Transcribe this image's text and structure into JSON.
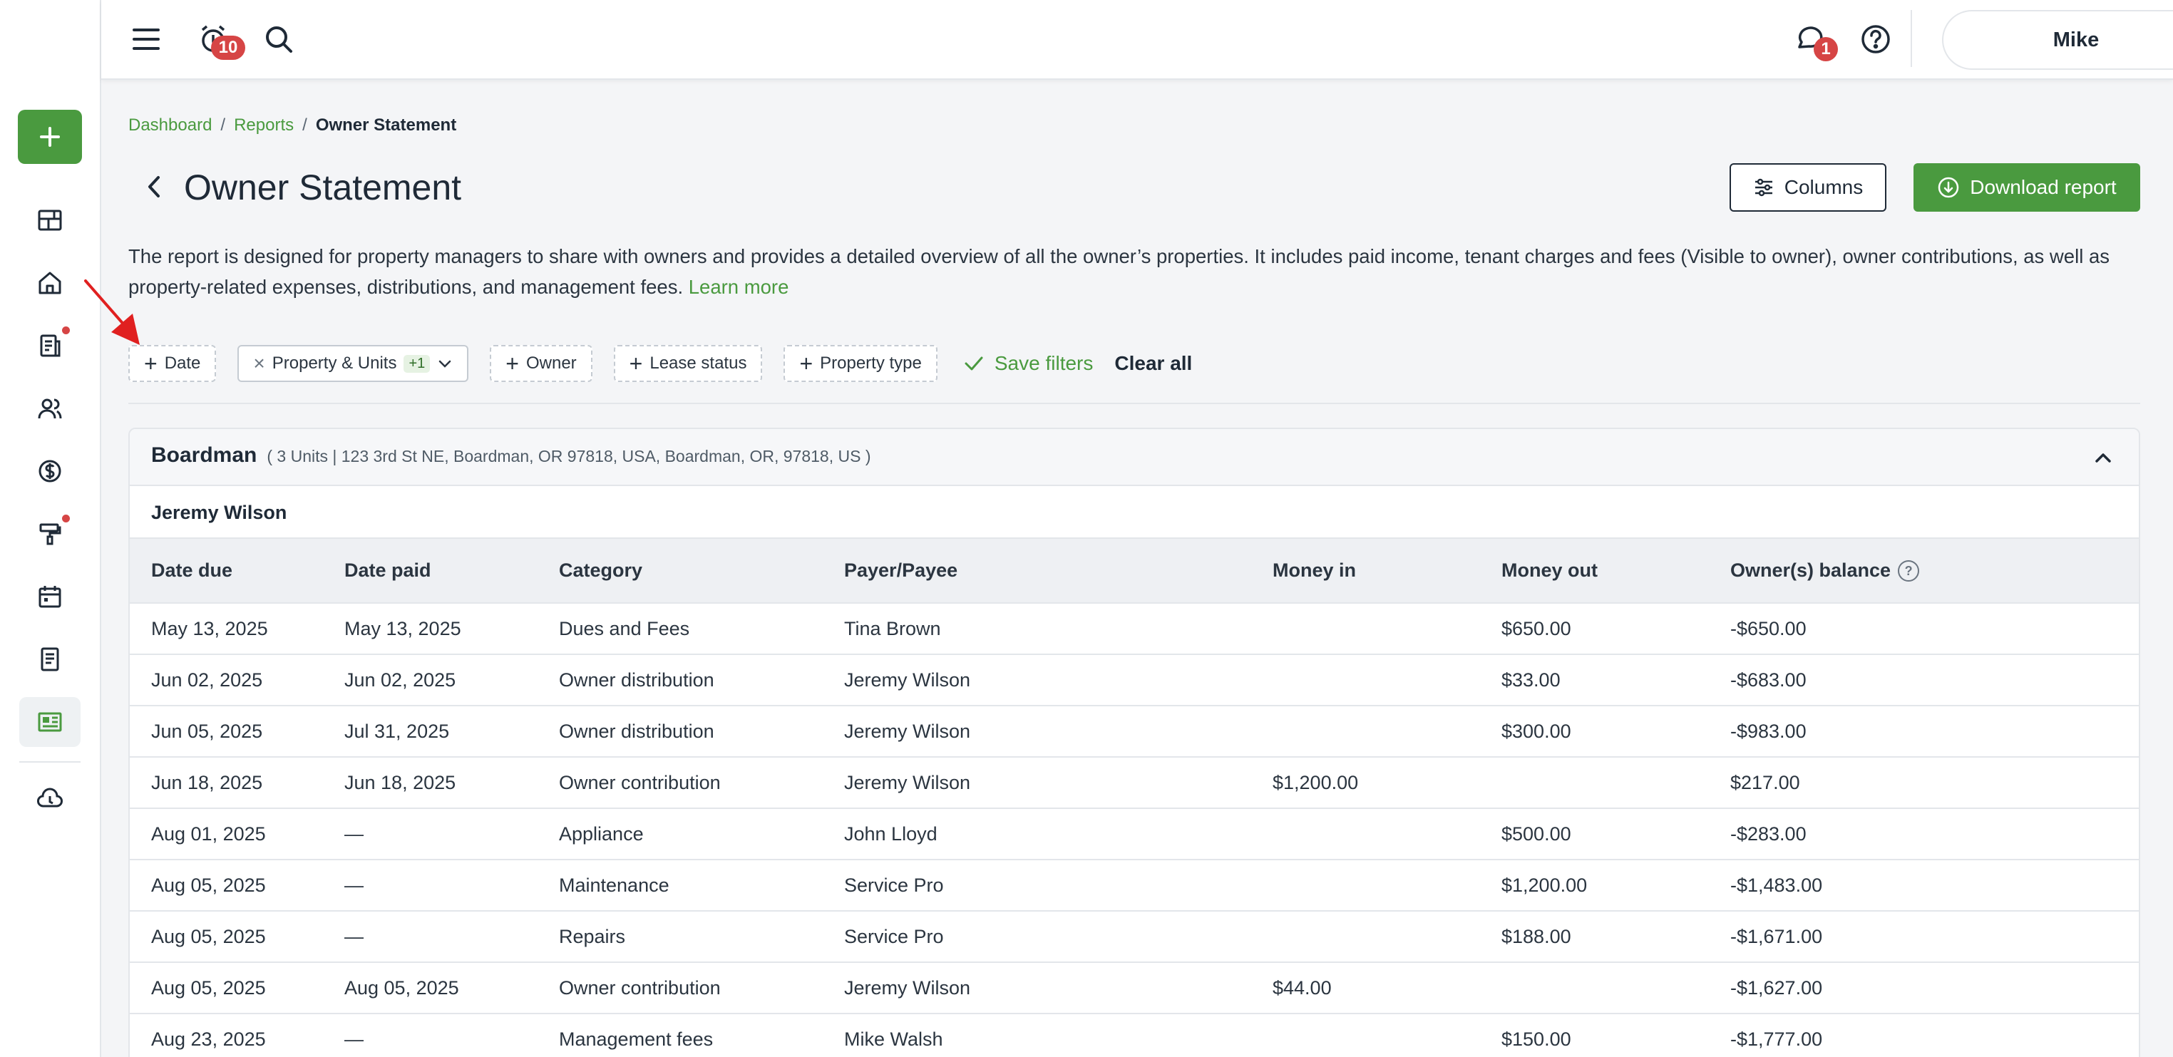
{
  "topbar": {
    "notifications_count": "10",
    "messages_count": "1",
    "user_name": "Mike"
  },
  "breadcrumb": {
    "items": [
      "Dashboard",
      "Reports"
    ],
    "separator": "/",
    "current": "Owner Statement"
  },
  "page": {
    "title": "Owner Statement",
    "columns_label": "Columns",
    "download_label": "Download report",
    "description": "The report is designed for property managers to share with owners and provides a detailed overview of all the owner’s properties. It includes paid income, tenant charges and fees (Visible to owner), owner contributions, as well as property-related expenses, distributions, and management fees.",
    "learn_more": "Learn more"
  },
  "filters": {
    "date": "Date",
    "property_units": "Property & Units",
    "property_units_count": "+1",
    "owner": "Owner",
    "lease_status": "Lease status",
    "property_type": "Property type",
    "save_filters": "Save filters",
    "clear_all": "Clear all"
  },
  "property": {
    "name": "Boardman",
    "meta": "( 3 Units | 123 3rd St NE, Boardman, OR 97818, USA, Boardman, OR, 97818, US )",
    "owner": "Jeremy Wilson"
  },
  "table": {
    "headers": [
      "Date due",
      "Date paid",
      "Category",
      "Payer/Payee",
      "Money in",
      "Money out",
      "Owner(s) balance"
    ],
    "rows": [
      [
        "May 13, 2025",
        "May 13, 2025",
        "Dues and Fees",
        "Tina Brown",
        "",
        "$650.00",
        "-$650.00"
      ],
      [
        "Jun 02, 2025",
        "Jun 02, 2025",
        "Owner distribution",
        "Jeremy Wilson",
        "",
        "$33.00",
        "-$683.00"
      ],
      [
        "Jun 05, 2025",
        "Jul 31, 2025",
        "Owner distribution",
        "Jeremy Wilson",
        "",
        "$300.00",
        "-$983.00"
      ],
      [
        "Jun 18, 2025",
        "Jun 18, 2025",
        "Owner contribution",
        "Jeremy Wilson",
        "$1,200.00",
        "",
        "$217.00"
      ],
      [
        "Aug 01, 2025",
        "—",
        "Appliance",
        "John Lloyd",
        "",
        "$500.00",
        "-$283.00"
      ],
      [
        "Aug 05, 2025",
        "—",
        "Maintenance",
        "Service Pro",
        "",
        "$1,200.00",
        "-$1,483.00"
      ],
      [
        "Aug 05, 2025",
        "—",
        "Repairs",
        "Service Pro",
        "",
        "$188.00",
        "-$1,671.00"
      ],
      [
        "Aug 05, 2025",
        "Aug 05, 2025",
        "Owner contribution",
        "Jeremy Wilson",
        "$44.00",
        "",
        "-$1,627.00"
      ],
      [
        "Aug 23, 2025",
        "—",
        "Management fees",
        "Mike Walsh",
        "",
        "$150.00",
        "-$1,777.00"
      ]
    ]
  },
  "sidebar": {
    "items": [
      "add-icon",
      "dashboard-icon",
      "home-icon",
      "leases-icon",
      "people-icon",
      "dollar-icon",
      "maintenance-icon",
      "calendar-icon",
      "document-icon",
      "reports-icon",
      "cloud-icon"
    ]
  },
  "colors": {
    "brand_green": "#4a9a3f",
    "badge_red": "#d64545",
    "annotation_arrow": "#e02020"
  }
}
